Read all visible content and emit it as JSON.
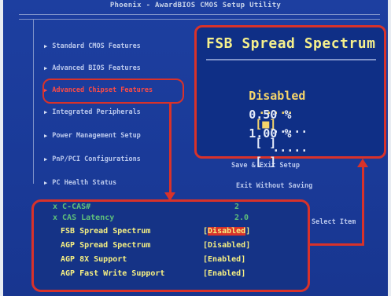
{
  "header": {
    "title": "Phoenix - AwardBIOS CMOS Setup Utility"
  },
  "menu": {
    "items": [
      "Standard CMOS Features",
      "Advanced BIOS Features",
      "Advanced Chipset Features",
      "Integrated Peripherals",
      "Power Management Setup",
      "PnP/PCI Configurations",
      "PC Health Status"
    ]
  },
  "right_menu": {
    "save_exit": "Save & Exit Setup",
    "exit_without_saving": "Exit Without Saving",
    "select_item": "Select Item"
  },
  "fsb_panel": {
    "title": "FSB Spread Spectrum",
    "options": [
      {
        "label": "Disabled",
        "dots": ".....",
        "mark": "[■]"
      },
      {
        "label": "0.50 %",
        "dots": ".....",
        "mark": "[ ]"
      },
      {
        "label": "1.00 %",
        "dots": ".....",
        "mark": "[ ]"
      }
    ]
  },
  "bottom_panel": {
    "rows": [
      {
        "name": "x C-CAS#",
        "value": "2"
      },
      {
        "name": "x CAS Latency",
        "value": "2.0"
      },
      {
        "name": "FSB Spread Spectrum",
        "value": "Disabled"
      },
      {
        "name": "AGP Spread Spectrum",
        "value": "Disabled"
      },
      {
        "name": "AGP 8X Support",
        "value": "Enabled"
      },
      {
        "name": "AGP Fast Write Support",
        "value": "Enabled"
      }
    ]
  },
  "colors": {
    "highlight_red": "#d8322a",
    "bios_blue": "#1d3fa0",
    "yellow": "#f5ef83"
  }
}
